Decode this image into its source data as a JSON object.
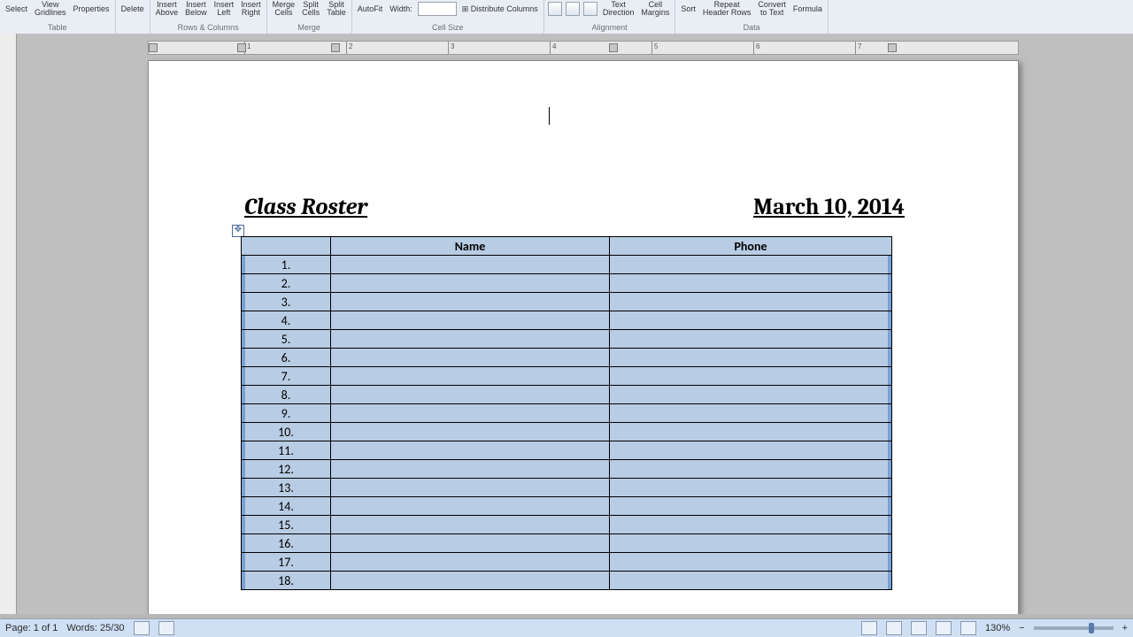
{
  "ribbon": {
    "groups": [
      {
        "label": "Table",
        "buttons": [
          {
            "l1": "Select",
            "l2": ""
          },
          {
            "l1": "View",
            "l2": "Gridlines"
          },
          {
            "l1": "Properties",
            "l2": ""
          }
        ]
      },
      {
        "label": "",
        "buttons": [
          {
            "l1": "Delete",
            "l2": ""
          }
        ]
      },
      {
        "label": "Rows & Columns",
        "buttons": [
          {
            "l1": "Insert",
            "l2": "Above"
          },
          {
            "l1": "Insert",
            "l2": "Below"
          },
          {
            "l1": "Insert",
            "l2": "Left"
          },
          {
            "l1": "Insert",
            "l2": "Right"
          }
        ]
      },
      {
        "label": "Merge",
        "buttons": [
          {
            "l1": "Merge",
            "l2": "Cells"
          },
          {
            "l1": "Split",
            "l2": "Cells"
          },
          {
            "l1": "Split",
            "l2": "Table"
          }
        ]
      },
      {
        "label": "Cell Size",
        "buttons": [
          {
            "l1": "AutoFit",
            "l2": ""
          }
        ],
        "width_label": "Width:",
        "dist_label": "Distribute Columns"
      },
      {
        "label": "Alignment",
        "buttons": [
          {
            "l1": "Text",
            "l2": "Direction"
          },
          {
            "l1": "Cell",
            "l2": "Margins"
          }
        ]
      },
      {
        "label": "Data",
        "buttons": [
          {
            "l1": "Sort",
            "l2": ""
          },
          {
            "l1": "Repeat",
            "l2": "Header Rows"
          },
          {
            "l1": "Convert",
            "l2": "to Text"
          },
          {
            "l1": "Formula",
            "l2": ""
          }
        ]
      }
    ]
  },
  "ruler_numbers": [
    "1",
    "2",
    "3",
    "4",
    "5",
    "6",
    "7"
  ],
  "document": {
    "title": "Class Roster",
    "date": "March 10, 2014",
    "columns": [
      "",
      "Name",
      "Phone"
    ],
    "rows": [
      "1.",
      "2.",
      "3.",
      "4.",
      "5.",
      "6.",
      "7.",
      "8.",
      "9.",
      "10.",
      "11.",
      "12.",
      "13.",
      "14.",
      "15.",
      "16.",
      "17.",
      "18."
    ]
  },
  "status": {
    "page": "Page: 1 of 1",
    "words": "Words: 25/30",
    "zoom": "130%"
  }
}
